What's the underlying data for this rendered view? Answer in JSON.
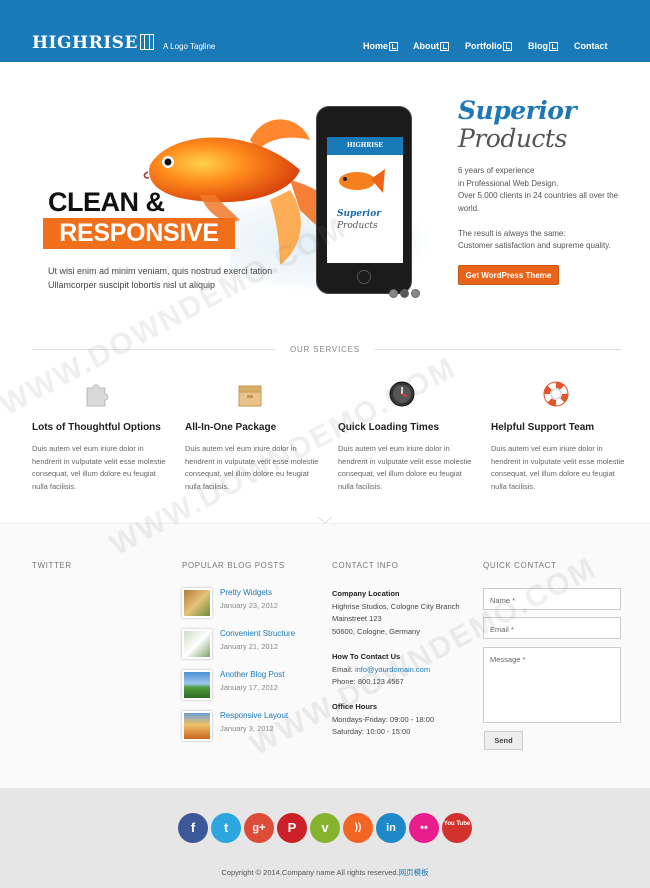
{
  "header": {
    "logo": "HIGHRISE",
    "tagline": "A Logo Tagline",
    "nav": [
      "Home",
      "About",
      "Portfolio",
      "Blog",
      "Contact"
    ],
    "accent": "#1a7ab8"
  },
  "hero": {
    "headline_top": "CLEAN &",
    "headline_bottom": "RESPONSIVE",
    "paragraph_line1": "Ut wisi enim ad minim veniam, quis nostrud exerci tation",
    "paragraph_line2": "Ullamcorper suscipit lobortis nisl ut aliquip",
    "phone_brand": "HIGHRISE",
    "phone_title": "Superior",
    "phone_subtitle": "Products",
    "slides": 3,
    "active_slide": 2,
    "title": "Superior",
    "subtitle": "Products",
    "body_lines": [
      "6 years of experience",
      "in Professional Web Design.",
      "Over 5.000 clients in 24 countries all over the",
      "world.",
      "",
      "The result is always the same:",
      "Customer satisfaction and supreme quality."
    ],
    "cta": "Get WordPress Theme",
    "cta_color": "#e8641a"
  },
  "services": {
    "heading": "OUR SERVICES",
    "items": [
      {
        "icon": "puzzle-icon",
        "title": "Lots of Thoughtful Options",
        "text": "Duis autem vel eum iriure dolor in hendrerit in vulputate velit esse molestie consequat, vel illum dolore eu feugiat nulla facilisis."
      },
      {
        "icon": "box-icon",
        "title": "All-In-One Package",
        "text": "Duis autem vel eum iriure dolor in hendrerit in vulputate velit esse molestie consequat, vel illum dolore eu feugiat nulla facilisis."
      },
      {
        "icon": "clock-icon",
        "title": "Quick Loading Times",
        "text": "Duis autem vel eum iriure dolor in hendrerit in vulputate velit esse molestie consequat, vel illum dolore eu feugiat nulla facilisis."
      },
      {
        "icon": "lifebuoy-icon",
        "title": "Helpful Support Team",
        "text": "Duis autem vel eum iriure dolor in hendrerit in vulputate velit esse molestie consequat, vel illum dolore eu feugiat nulla facilisis."
      }
    ]
  },
  "footer": {
    "twitter_heading": "TWITTER",
    "posts_heading": "POPULAR BLOG POSTS",
    "posts": [
      {
        "title": "Pretty Widgets",
        "date": "January 23, 2012"
      },
      {
        "title": "Convenient Structure",
        "date": "January 21, 2012"
      },
      {
        "title": "Another Blog Post",
        "date": "January 17, 2012"
      },
      {
        "title": "Responsive Layout",
        "date": "January 3, 2012"
      }
    ],
    "contact_heading": "CONTACT INFO",
    "location_label": "Company Location",
    "location_lines": [
      "Highrise Studios, Cologne City Branch",
      "Mainstreet 123",
      "50600, Cologne, Germany"
    ],
    "reach_label": "How To Contact Us",
    "email_label": "Email:",
    "email": "info@yourdomain.com",
    "phone_line": "Phone: 800.123.4567",
    "hours_label": "Office Hours",
    "hours_lines": [
      "Mondays-Friday: 09:00 - 18:00",
      "Saturday: 10:00 - 15:00"
    ],
    "quick_heading": "QUICK CONTACT",
    "name_placeholder": "Name *",
    "email_placeholder": "Email *",
    "message_placeholder": "Message *",
    "send_label": "Send"
  },
  "social": [
    {
      "icon": "facebook-icon",
      "glyph": "f",
      "color": "#3b5998"
    },
    {
      "icon": "twitter-icon",
      "glyph": "t",
      "color": "#2ba6de"
    },
    {
      "icon": "googleplus-icon",
      "glyph": "g+",
      "color": "#dd4b39"
    },
    {
      "icon": "pinterest-icon",
      "glyph": "P",
      "color": "#cb2027"
    },
    {
      "icon": "vimeo-icon",
      "glyph": "v",
      "color": "#86b32d"
    },
    {
      "icon": "rss-icon",
      "glyph": "))",
      "color": "#f26522"
    },
    {
      "icon": "linkedin-icon",
      "glyph": "in",
      "color": "#1e88c8"
    },
    {
      "icon": "flickr-icon",
      "glyph": "••",
      "color": "#e91e8c"
    },
    {
      "icon": "youtube-icon",
      "glyph": "You Tube",
      "color": "#d2322d"
    }
  ],
  "copyright": "Copyright © 2014.Company name All rights reserved.",
  "copyright_link": "网页模板",
  "watermark": "WWW.DOWNDEMO.COM"
}
